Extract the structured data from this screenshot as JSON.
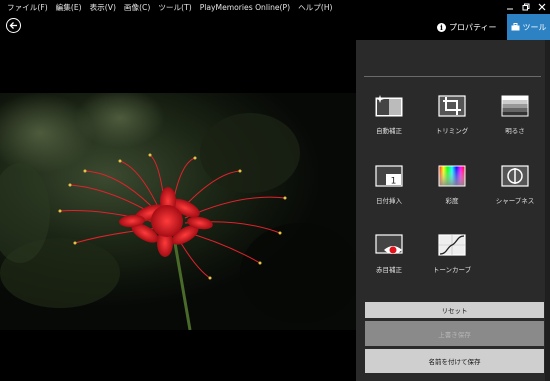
{
  "menu": [
    "ファイル(F)",
    "編集(E)",
    "表示(V)",
    "画像(C)",
    "ツール(T)",
    "PlayMemories Online(P)",
    "ヘルプ(H)"
  ],
  "toolbar": {
    "properties_label": "プロパティー",
    "tools_label": "ツール"
  },
  "tools": [
    {
      "label": "自動補正",
      "icon": "auto-correct-icon"
    },
    {
      "label": "トリミング",
      "icon": "crop-icon"
    },
    {
      "label": "明るさ",
      "icon": "brightness-icon"
    },
    {
      "label": "日付挿入",
      "icon": "date-insert-icon"
    },
    {
      "label": "彩度",
      "icon": "saturation-icon"
    },
    {
      "label": "シャープネス",
      "icon": "sharpness-icon"
    },
    {
      "label": "赤目補正",
      "icon": "red-eye-icon"
    },
    {
      "label": "トーンカーブ",
      "icon": "tone-curve-icon"
    }
  ],
  "buttons": {
    "reset": "リセット",
    "overwrite": "上書き保存",
    "save_as": "名前を付けて保存"
  },
  "colors": {
    "accent": "#2d82c4",
    "panel": "#2a2a2a",
    "flower": "#d01a22"
  }
}
